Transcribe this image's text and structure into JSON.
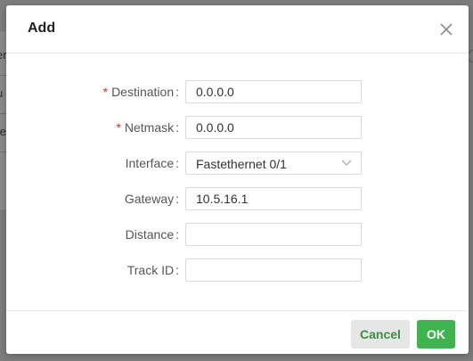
{
  "dialog": {
    "title": "Add"
  },
  "background": {
    "fragments": [
      "er",
      "u",
      "te"
    ]
  },
  "form": {
    "fields": [
      {
        "label": "Destination",
        "required": true,
        "value": "0.0.0.0",
        "type": "text"
      },
      {
        "label": "Netmask",
        "required": true,
        "value": "0.0.0.0",
        "type": "text"
      },
      {
        "label": "Interface",
        "required": false,
        "value": "Fastethernet 0/1",
        "type": "select"
      },
      {
        "label": "Gateway",
        "required": false,
        "value": "10.5.16.1",
        "type": "text"
      },
      {
        "label": "Distance",
        "required": false,
        "value": "",
        "type": "text"
      },
      {
        "label": "Track ID",
        "required": false,
        "value": "",
        "type": "text"
      }
    ],
    "required_marker": "*",
    "colon": ":"
  },
  "footer": {
    "cancel_label": "Cancel",
    "ok_label": "OK"
  },
  "colors": {
    "primary": "#3fb34f",
    "cancel_text": "#3b8f43",
    "required": "#e02d2d"
  },
  "icons": {
    "close": "close-icon",
    "select_arrow": "chevron-down-icon"
  }
}
